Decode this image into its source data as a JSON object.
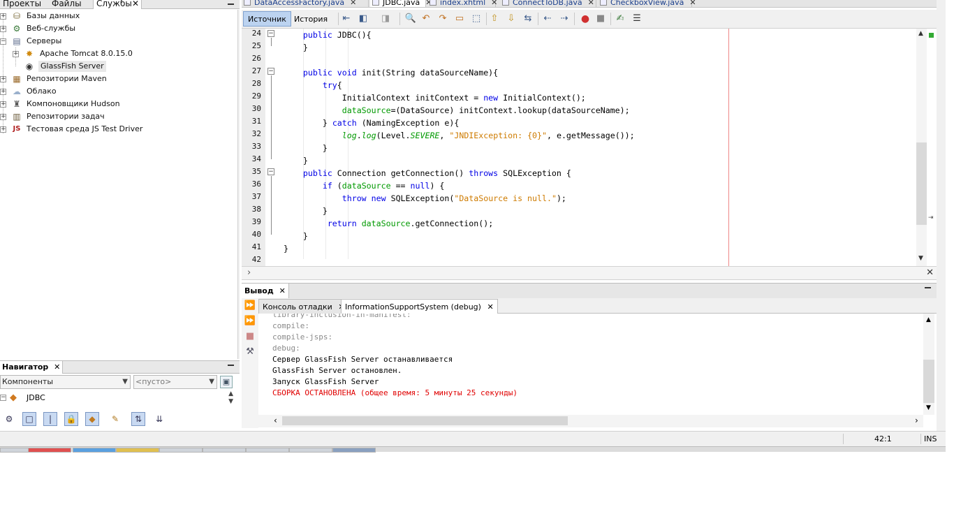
{
  "left_tabs": [
    "Проекты",
    "Файлы",
    "Службы"
  ],
  "left_tabs_close": "✕",
  "services_tree": [
    {
      "label": "Базы данных",
      "icon": "database-icon"
    },
    {
      "label": "Веб-службы",
      "icon": "web-services-icon"
    },
    {
      "label": "Серверы",
      "icon": "servers-icon"
    },
    {
      "label": "Apache Tomcat 8.0.15.0",
      "icon": "tomcat-icon"
    },
    {
      "label": "GlassFish Server",
      "icon": "glassfish-icon"
    },
    {
      "label": "Репозитории Maven",
      "icon": "maven-icon"
    },
    {
      "label": "Облако",
      "icon": "cloud-icon"
    },
    {
      "label": "Компоновщики Hudson",
      "icon": "hudson-icon"
    },
    {
      "label": "Репозитории задач",
      "icon": "task-repo-icon"
    },
    {
      "label": "Тестовая среда JS Test Driver",
      "icon": "js-test-driver-icon"
    }
  ],
  "navigator": {
    "title": "Навигатор",
    "combo_left": "Компоненты",
    "combo_right": "<пусто>",
    "root_item": "JDBC"
  },
  "editor_tabs": [
    {
      "label": "DataAccessFactory.java",
      "selected": false
    },
    {
      "label": "JDBC.java",
      "selected": true
    },
    {
      "label": "index.xhtml",
      "selected": false
    },
    {
      "label": "ConnectToDB.java",
      "selected": false
    },
    {
      "label": "CheckboxView.java",
      "selected": false
    }
  ],
  "editor_views": {
    "source": "Источник",
    "history": "История"
  },
  "line_numbers": [
    "24",
    "25",
    "26",
    "27",
    "28",
    "29",
    "30",
    "31",
    "32",
    "33",
    "34",
    "35",
    "36",
    "37",
    "38",
    "39",
    "40",
    "41",
    "42"
  ],
  "code_lines": [
    "    public JDBC(){",
    "    }",
    "",
    "    public void init(String dataSourceName){",
    "        try{",
    "            InitialContext initContext = new InitialContext();",
    "            dataSource=(DataSource) initContext.lookup(dataSourceName);",
    "        } catch (NamingException e){",
    "            log.log(Level.SEVERE, \"JNDIException: {0}\", e.getMessage());",
    "        }",
    "    }",
    "    public Connection getConnection() throws SQLException {",
    "        if (dataSource == null) {",
    "            throw new SQLException(\"DataSource is null.\");",
    "        }",
    "         return dataSource.getConnection();",
    "    }",
    "}",
    ""
  ],
  "output": {
    "title": "Вывод",
    "tabs": [
      {
        "label": "Консоль отладки",
        "selected": false
      },
      {
        "label": "InformationSupportSystem (debug)",
        "selected": true
      }
    ],
    "lines": [
      {
        "text": "library-inclusion-in-manifest:",
        "kind": "grey"
      },
      {
        "text": "compile:",
        "kind": "grey"
      },
      {
        "text": "compile-jsps:",
        "kind": "grey"
      },
      {
        "text": "debug:",
        "kind": "grey"
      },
      {
        "text": "Сервер GlassFish Server останавливается",
        "kind": "normal"
      },
      {
        "text": "GlassFish Server остановлен.",
        "kind": "normal"
      },
      {
        "text": "Запуск GlassFish Server",
        "kind": "normal"
      },
      {
        "text": "СБОРКА ОСТАНОВЛЕНА (общее время: 5 минуты 25 секунды)",
        "kind": "error"
      }
    ]
  },
  "status": {
    "position": "42:1",
    "mode": "INS"
  },
  "colors": {
    "keyword": "#0000e6",
    "field": "#009900",
    "string": "#ce7b00",
    "error": "#e00000",
    "grey": "#8a8a8a"
  }
}
